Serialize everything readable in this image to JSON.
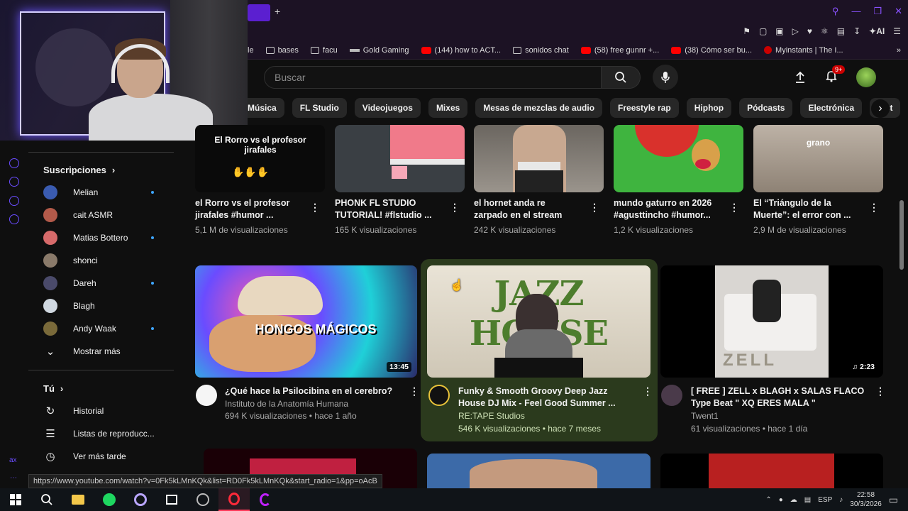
{
  "browser": {
    "new_tab_label": "+",
    "ai_label": "AI",
    "bookmarks": [
      {
        "icon": "partial",
        "label": "le"
      },
      {
        "icon": "folder-icon",
        "label": "bases"
      },
      {
        "icon": "folder-icon",
        "label": "facu"
      },
      {
        "icon": "gold-gaming-icon",
        "label": "Gold Gaming"
      },
      {
        "icon": "youtube-icon",
        "label": "(144) how to ACT..."
      },
      {
        "icon": "folder-icon",
        "label": "sonidos chat"
      },
      {
        "icon": "youtube-icon",
        "label": "(58) free gunnr +..."
      },
      {
        "icon": "youtube-icon",
        "label": "(38) Cómo ser bu..."
      },
      {
        "icon": "myinstants-icon",
        "label": "Myinstants | The I..."
      }
    ]
  },
  "header": {
    "search_placeholder": "Buscar",
    "notification_badge": "9+"
  },
  "chips": [
    "Música",
    "FL Studio",
    "Videojuegos",
    "Mixes",
    "Mesas de mezclas de audio",
    "Freestyle rap",
    "Hiphop",
    "Pódcasts",
    "Electrónica",
    "List"
  ],
  "sidebar": {
    "subscriptions_title": "Suscripciones",
    "subscriptions": [
      {
        "name": "Melian",
        "new": true,
        "color": "#3a5bb0"
      },
      {
        "name": "cait ASMR",
        "new": false,
        "color": "#b35a4a"
      },
      {
        "name": "Matias Bottero",
        "new": true,
        "color": "#d66a6a"
      },
      {
        "name": "shonci",
        "new": false,
        "color": "#8a7a6a"
      },
      {
        "name": "Dareh",
        "new": true,
        "color": "#4a4a6a"
      },
      {
        "name": "Blagh",
        "new": false,
        "color": "#d0d8e0"
      },
      {
        "name": "Andy Waak",
        "new": true,
        "color": "#7a6a3a"
      }
    ],
    "show_more": "Mostrar más",
    "you_title": "Tú",
    "you_items": [
      {
        "icon": "history-icon",
        "label": "Historial"
      },
      {
        "icon": "playlists-icon",
        "label": "Listas de reproducc..."
      },
      {
        "icon": "watch-later-icon",
        "label": "Ver más tarde"
      }
    ]
  },
  "shorts": [
    {
      "thumb_text": "El Rorro vs el profesor jirafales",
      "title_line1": "el Rorro vs el profesor",
      "title_line2": "jirafales #humor ...",
      "views": "5,1 M de visualizaciones"
    },
    {
      "thumb_text": "",
      "title_line1": "PHONK FL STUDIO",
      "title_line2": "TUTORIAL! #flstudio ...",
      "views": "165 K visualizaciones"
    },
    {
      "thumb_text": "",
      "title_line1": "el hornet anda re",
      "title_line2": "zarpado en el stream",
      "views": "242 K visualizaciones"
    },
    {
      "thumb_text": "",
      "title_line1": "mundo gaturro en 2026",
      "title_line2": "#agusttincho #humor...",
      "views": "1,2 K visualizaciones"
    },
    {
      "thumb_text": "grano",
      "title_line1": "El “Triángulo de la",
      "title_line2": "Muerte”: el error con ...",
      "views": "2,9 M de visualizaciones"
    }
  ],
  "videos": [
    {
      "thumb_text": "HONGOS MÁGICOS",
      "duration": "13:45",
      "title_line1": "¿Qué hace la Psilocibina en el cerebro?",
      "title_line2": "",
      "channel": "Instituto de la Anatomía Humana",
      "meta": "694 K visualizaciones • hace 1 año"
    },
    {
      "thumb_text": "JAZZ HOUSE",
      "duration": "",
      "title_line1": "Funky & Smooth Groovy Deep Jazz",
      "title_line2": "House DJ Mix - Feel Good Summer ...",
      "channel": "RE:TAPE Studios",
      "meta": "546 K visualizaciones • hace 7 meses"
    },
    {
      "thumb_text": "ZELL",
      "duration": "2:23",
      "title_line1": "[ FREE ] ZELL x BLAGH x SALAS FLACO",
      "title_line2": "Type Beat \" XQ ERES MALA \"",
      "channel": "Twent1",
      "meta": "61 visualizaciones • hace 1 día"
    }
  ],
  "status_url": "https://www.youtube.com/watch?v=0Fk5kLMnKQk&list=RD0Fk5kLMnKQk&start_radio=1&pp=oAcB",
  "taskbar": {
    "language": "ESP",
    "time": "22:58",
    "date": "30/3/2026"
  }
}
